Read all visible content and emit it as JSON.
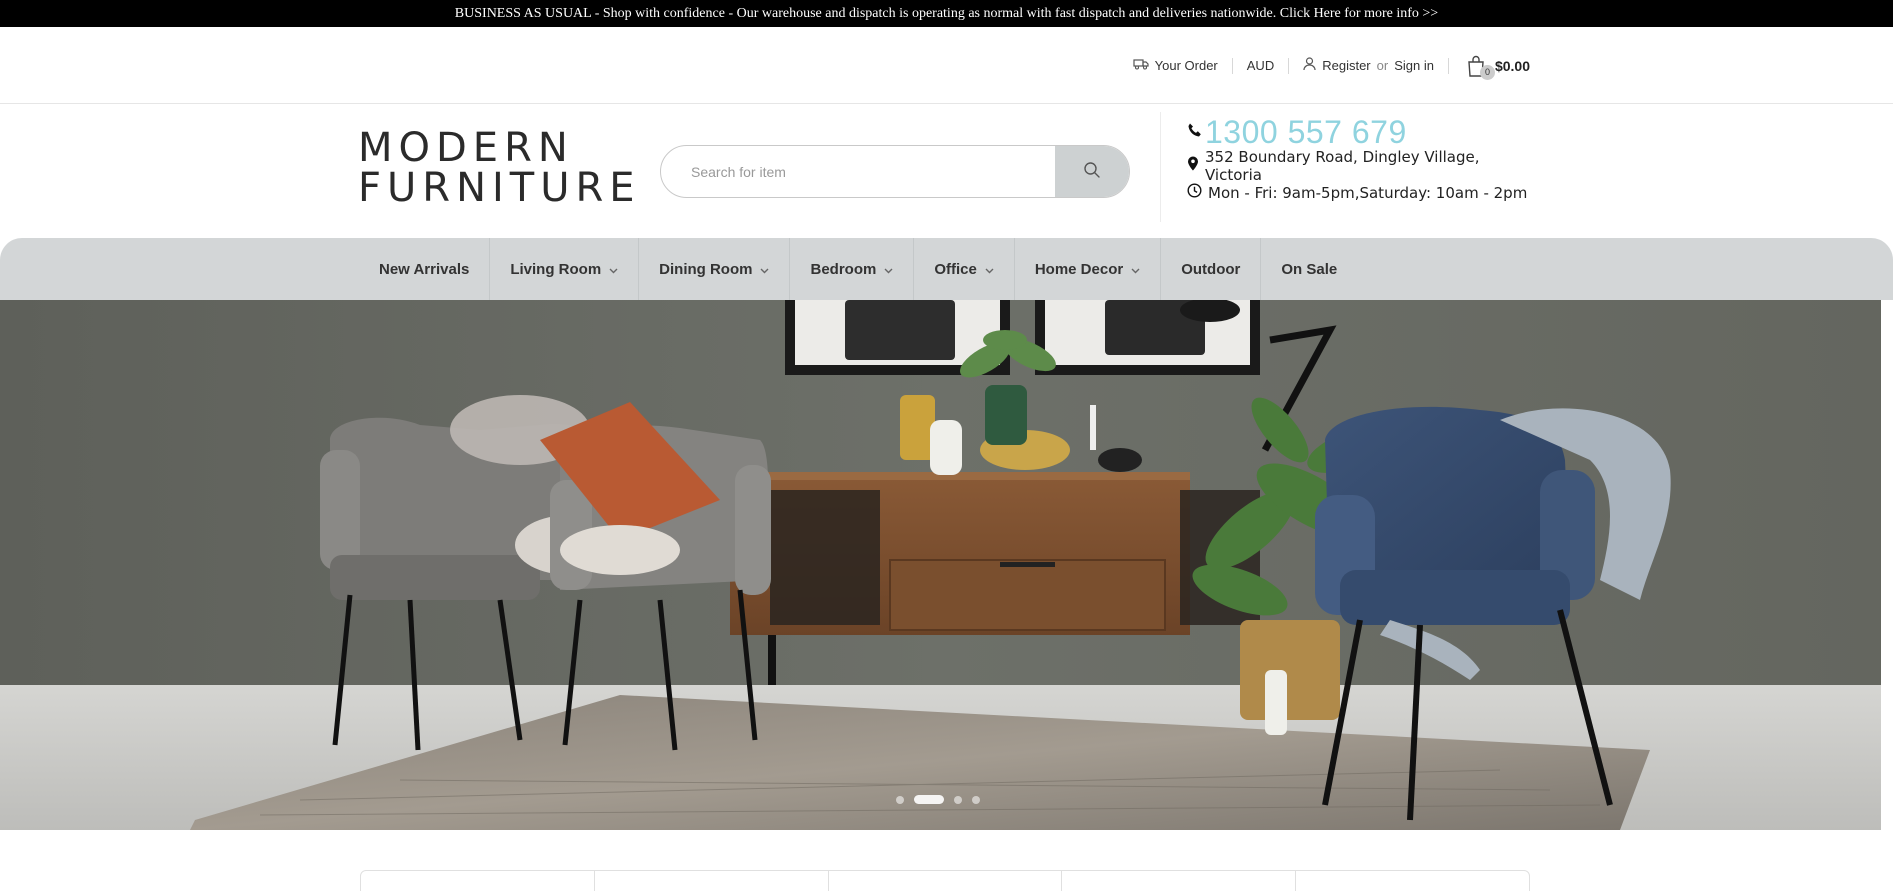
{
  "announcement": "BUSINESS AS USUAL - Shop with confidence - Our warehouse and dispatch is operating as normal with fast dispatch and deliveries nationwide. Click Here for more info >>",
  "topbar": {
    "your_order": "Your Order",
    "currency": "AUD",
    "register": "Register",
    "or": "or",
    "sign_in": "Sign in",
    "cart_count": "0",
    "cart_total": "$0.00"
  },
  "logo": {
    "line1": "MODERN",
    "line2": "FURNITURE"
  },
  "search": {
    "placeholder": "Search for item"
  },
  "contact": {
    "phone": "1300 557 679",
    "address": "352 Boundary Road, Dingley Village, Victoria",
    "hours": "Mon - Fri: 9am-5pm,Saturday: 10am - 2pm"
  },
  "nav": {
    "items": [
      {
        "label": "New Arrivals",
        "dropdown": false
      },
      {
        "label": "Living Room",
        "dropdown": true
      },
      {
        "label": "Dining Room",
        "dropdown": true
      },
      {
        "label": "Bedroom",
        "dropdown": true
      },
      {
        "label": "Office",
        "dropdown": true
      },
      {
        "label": "Home Decor",
        "dropdown": true
      },
      {
        "label": "Outdoor",
        "dropdown": false
      },
      {
        "label": "On Sale",
        "dropdown": false
      }
    ]
  },
  "slider": {
    "slide_count": 4,
    "active_index": 1
  },
  "colors": {
    "phone": "#8fd3df",
    "nav_bg": "#d3d6d7",
    "announcement_bg": "#000000"
  }
}
